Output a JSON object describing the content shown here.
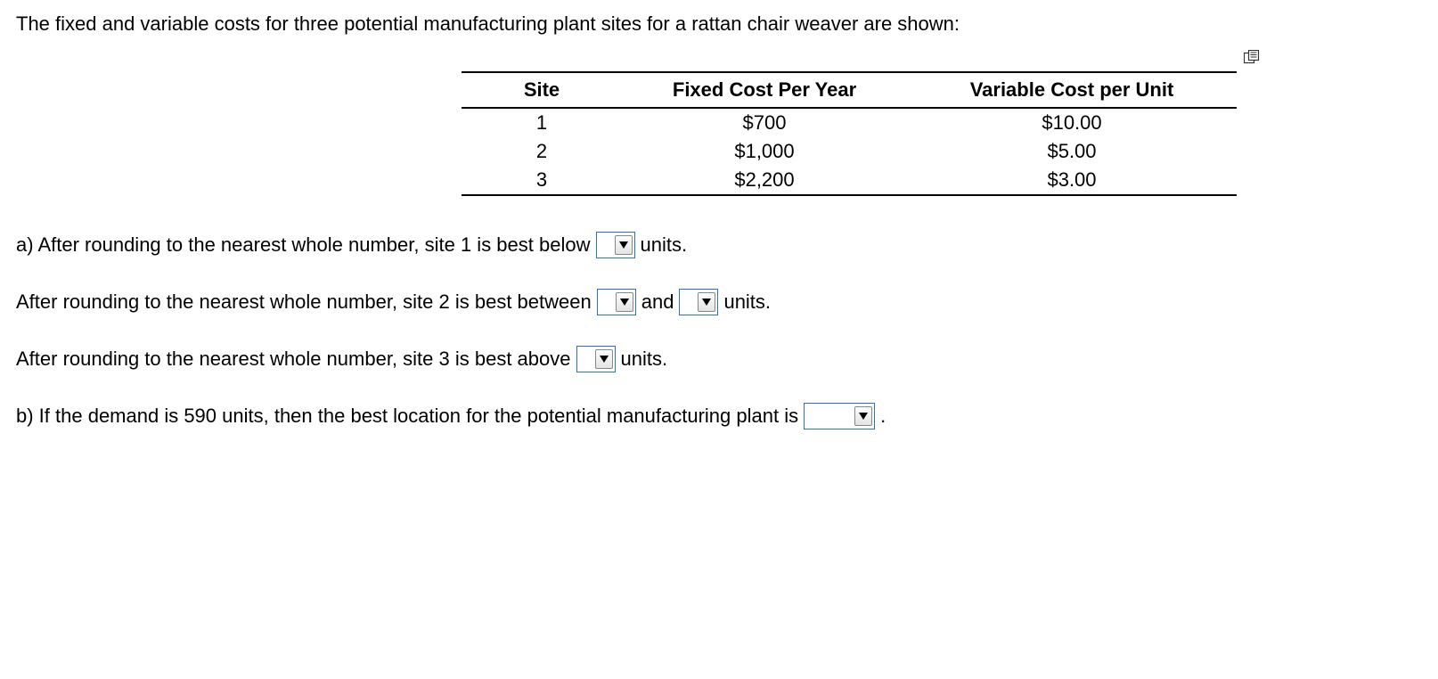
{
  "intro": "The fixed and variable costs for three potential manufacturing plant sites for a rattan chair weaver are shown:",
  "table": {
    "headers": {
      "site": "Site",
      "fixed": "Fixed Cost Per Year",
      "variable": "Variable Cost per Unit"
    },
    "rows": [
      {
        "site": "1",
        "fixed": "$700",
        "variable": "$10.00"
      },
      {
        "site": "2",
        "fixed": "$1,000",
        "variable": "$5.00"
      },
      {
        "site": "3",
        "fixed": "$2,200",
        "variable": "$3.00"
      }
    ]
  },
  "qA1": {
    "pre": "a) After rounding to the nearest whole number, site 1 is best below",
    "post": "units."
  },
  "qA2": {
    "pre": "After rounding to the nearest whole number, site 2 is best between",
    "mid": "and",
    "post": "units."
  },
  "qA3": {
    "pre": "After rounding to the nearest whole number, site 3 is best above",
    "post": "units."
  },
  "qB": {
    "pre": "b) If the demand is 590 units, then the best location for the potential manufacturing plant is",
    "post": "."
  }
}
